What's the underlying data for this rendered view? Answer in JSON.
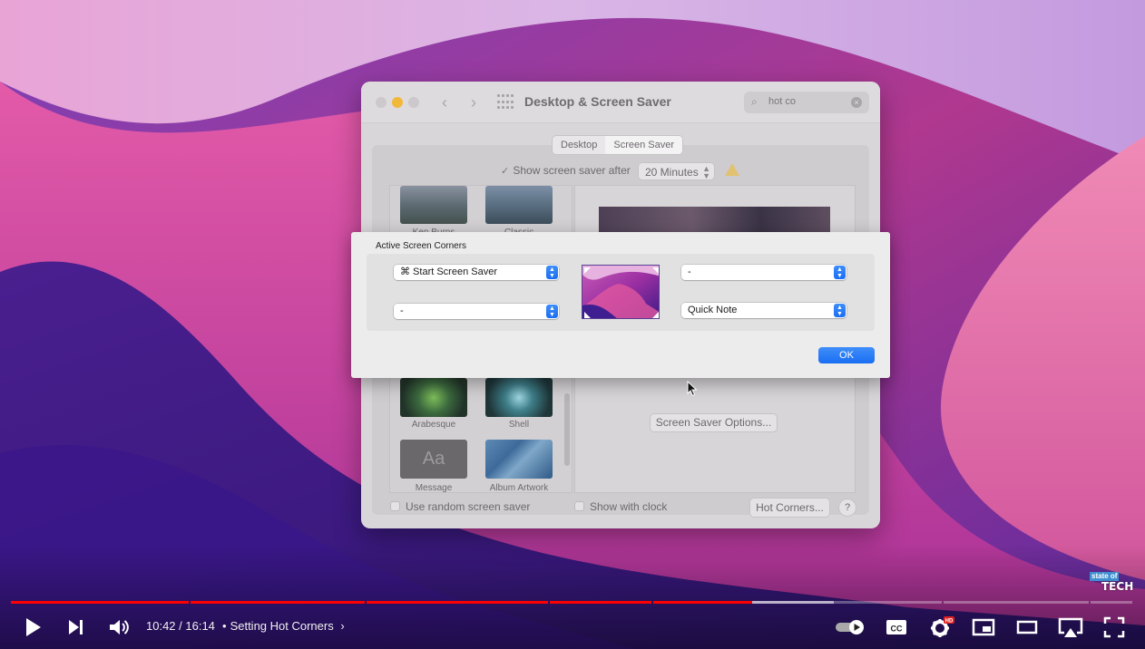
{
  "window": {
    "title": "Desktop & Screen Saver",
    "search_value": "hot co",
    "tabs": [
      {
        "label": "Desktop",
        "active": false
      },
      {
        "label": "Screen Saver",
        "active": true
      }
    ],
    "show_after_label": "Show screen saver after",
    "show_after_checked": true,
    "show_after_value": "20 Minutes",
    "screensavers": [
      {
        "label": "Ken Burns"
      },
      {
        "label": "Classic"
      },
      {
        "label": "Arabesque"
      },
      {
        "label": "Shell"
      },
      {
        "label": "Message"
      },
      {
        "label": "Album Artwork"
      }
    ],
    "message_thumb_text": "Aa",
    "options_button": "Screen Saver Options...",
    "random_label": "Use random screen saver",
    "clock_label": "Show with clock",
    "hot_corners_button": "Hot Corners...",
    "help_button": "?"
  },
  "sheet": {
    "title": "Active Screen Corners",
    "top_left": "⌘ Start Screen Saver",
    "top_right": "-",
    "bottom_left": "-",
    "bottom_right": "Quick Note",
    "ok_label": "OK"
  },
  "player": {
    "time": "10:42 / 16:14",
    "chapter": "Setting Hot Corners",
    "progress_fraction": 0.66,
    "buffered_fraction": 0.733,
    "hd_badge": "HD",
    "cc_label": "CC"
  },
  "watermark": {
    "line1": "state of",
    "line2": "TECH"
  }
}
